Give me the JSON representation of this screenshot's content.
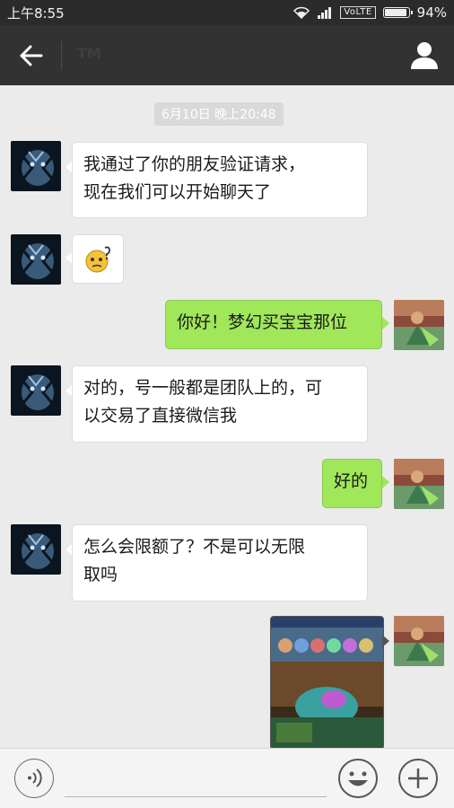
{
  "status_bar": {
    "time": "上午8:55",
    "network": "VoLTE",
    "battery": "94%",
    "battery_level": 0.94
  },
  "header": {
    "title": "TM",
    "back_icon": "back-arrow-icon",
    "profile_icon": "person-icon"
  },
  "timestamp": "6月10日 晚上20:48",
  "messages": [
    {
      "side": "in",
      "text_lines": [
        "我通过了你的朋友验证请求，",
        "现在我们可以开始聊天了"
      ]
    },
    {
      "side": "in",
      "type": "sticker",
      "icon": "confused-face-emoji"
    },
    {
      "side": "out",
      "text": "你好！梦幻买宝宝那位"
    },
    {
      "side": "in",
      "text_lines": [
        "对的，号一般都是团队上的，可",
        "以交易了直接微信我"
      ]
    },
    {
      "side": "out",
      "text": "好的"
    },
    {
      "side": "in",
      "text_lines": [
        "怎么会限额了？不是可以无限",
        "取吗"
      ]
    },
    {
      "side": "out",
      "type": "image",
      "icon": "game-screenshot-image"
    }
  ],
  "input_bar": {
    "voice_icon": "voice-icon",
    "emoji_icon": "smiley-icon",
    "plus_icon": "plus-icon"
  },
  "colors": {
    "status_bar": "#2b2b2b",
    "title_bar": "#323232",
    "chat_bg": "#ebebeb",
    "out_bubble": "#a0e75a",
    "in_bubble": "#ffffff"
  }
}
